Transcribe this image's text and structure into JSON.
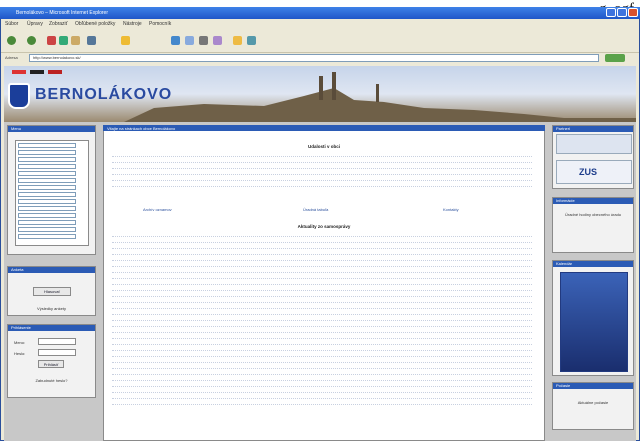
{
  "caption": "g .ogf",
  "window": {
    "title": "Bernolákovo – Microsoft Internet Explorer"
  },
  "menu": [
    "Súbor",
    "Úpravy",
    "Zobraziť",
    "Obľúbené položky",
    "Nástroje",
    "Pomocník"
  ],
  "address": {
    "label": "Adresa",
    "value": "http://www.bernolakovo.sk/"
  },
  "site": {
    "name": "BERNOLÁKOVO"
  },
  "sidebar": {
    "menu_title": "Menu",
    "poll_title": "Anketa",
    "poll_button": "Hlasovať",
    "poll_note": "Výsledky ankety",
    "login_title": "Prihlásenie",
    "login_name": "Meno:",
    "login_pass": "Heslo:",
    "login_button": "Prihlásiť",
    "login_note": "Zabudnuté heslo?"
  },
  "main": {
    "header": "Vitajte na stránkach obce Bernolákovo",
    "section1": "Udalosti v obci",
    "section2": "Aktuality zo samosprávy",
    "links": [
      "Archív oznamov",
      "Úradná tabuľa",
      "Kontakty"
    ]
  },
  "right": {
    "box1_title": "Partneri",
    "box2_title": "Informácie",
    "box3_title": "Kalendár",
    "box4_title": "Počasie",
    "box2_text": "Úradné hodiny obecného úradu",
    "box4_text": "Aktuálne počasie"
  }
}
